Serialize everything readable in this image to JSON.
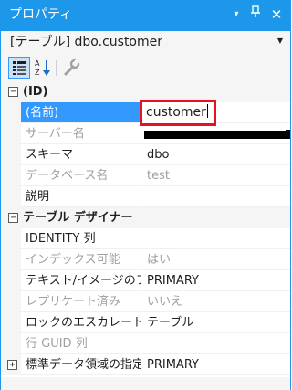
{
  "titlebar": {
    "title": "プロパティ",
    "dropdown_icon": "▾",
    "pin_icon": "𝟦",
    "close_icon": "✕"
  },
  "object_selector": {
    "label": "[テーブル] dbo.customer"
  },
  "toolbar": {
    "categorized_icon": "categorized-icon",
    "alphabetical_icon": "alphabetical-sort-icon",
    "property_pages_icon": "wrench-icon"
  },
  "grid": {
    "cat_id": {
      "toggle": "−",
      "label": "(ID)"
    },
    "name": {
      "label": "(名前)",
      "value": "customer"
    },
    "server": {
      "label": "サーバー名",
      "value": ""
    },
    "schema": {
      "label": "スキーマ",
      "value": "dbo"
    },
    "database": {
      "label": "データベース名",
      "value": "test"
    },
    "description": {
      "label": "説明",
      "value": ""
    },
    "cat_designer": {
      "toggle": "−",
      "label": "テーブル デザイナー"
    },
    "identity": {
      "label": "IDENTITY 列",
      "value": ""
    },
    "indexable": {
      "label": "インデックス可能",
      "value": "はい"
    },
    "text_image": {
      "label": "テキスト/イメージのファイ",
      "value": "PRIMARY"
    },
    "replicated": {
      "label": "レプリケート済み",
      "value": "いいえ"
    },
    "lock_escalation": {
      "label": "ロックのエスカレート",
      "value": "テーブル"
    },
    "rowguid": {
      "label": "行 GUID 列",
      "value": ""
    },
    "dataspace": {
      "toggle": "+",
      "label": "標準データ領域の指定",
      "value": "PRIMARY"
    }
  },
  "colors": {
    "accent": "#1c97ea",
    "selection": "#3399ff",
    "highlight_box": "#e81123"
  }
}
